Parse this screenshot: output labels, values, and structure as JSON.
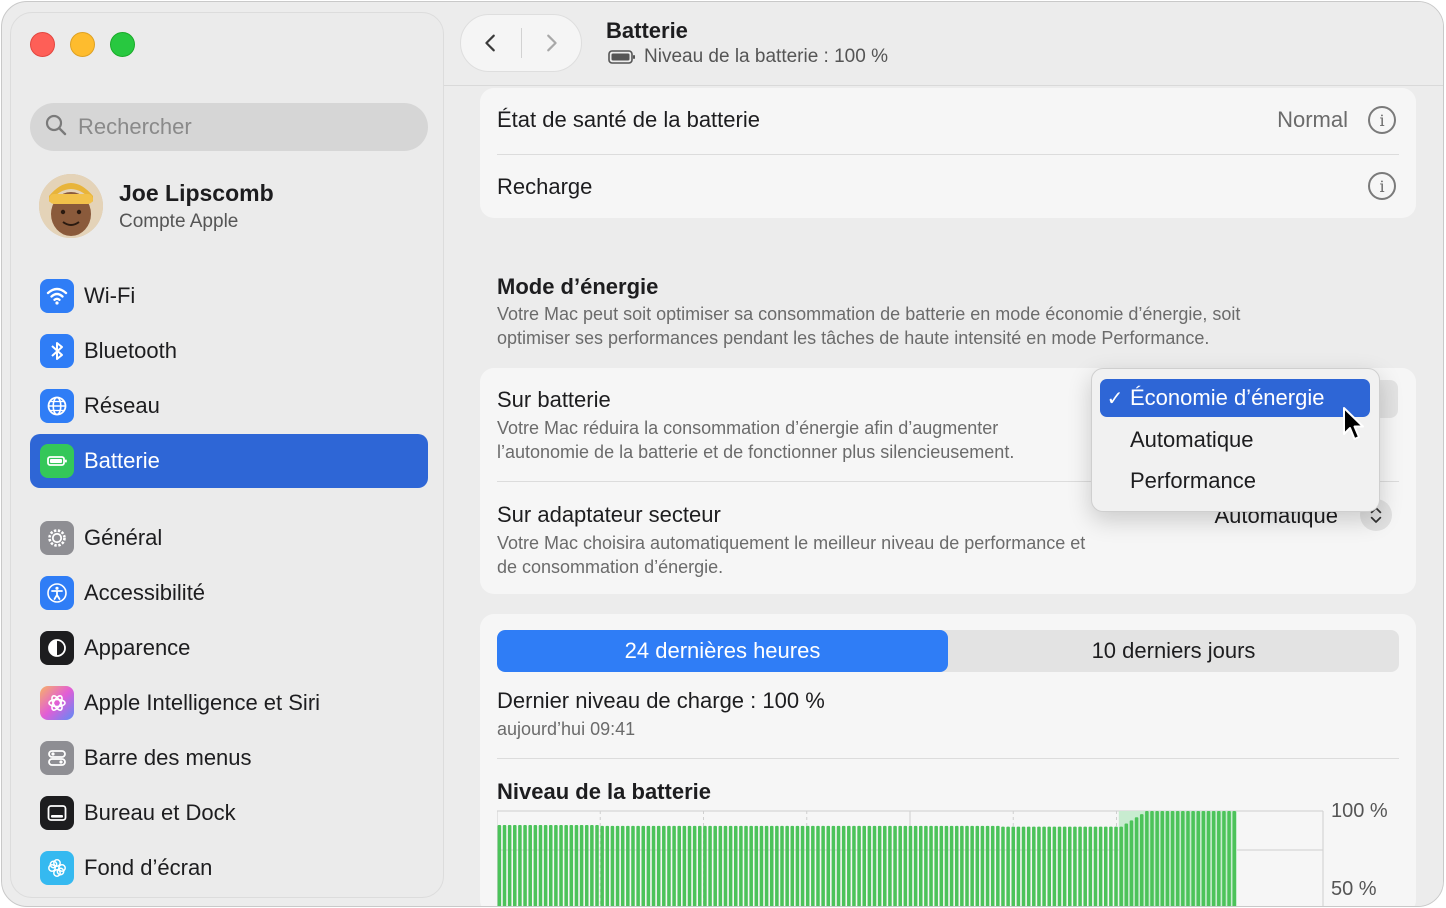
{
  "sidebar": {
    "search_placeholder": "Rechercher",
    "account": {
      "name": "Joe Lipscomb",
      "subtitle": "Compte Apple"
    },
    "items": [
      {
        "label": "Wi-Fi",
        "icon": "wifi-icon",
        "color": "#2f7df6"
      },
      {
        "label": "Bluetooth",
        "icon": "bluetooth-icon",
        "color": "#2f7df6"
      },
      {
        "label": "Réseau",
        "icon": "globe-icon",
        "color": "#2f7df6"
      },
      {
        "label": "Batterie",
        "icon": "battery-icon",
        "color": "#34c759",
        "active": true
      },
      {
        "label": "Général",
        "icon": "gear-icon",
        "color": "#8e8e93"
      },
      {
        "label": "Accessibilité",
        "icon": "accessibility-icon",
        "color": "#2f7df6"
      },
      {
        "label": "Apparence",
        "icon": "appearance-icon",
        "color": "#1d1d1f"
      },
      {
        "label": "Apple Intelligence et Siri",
        "icon": "siri-icon",
        "color": "#e25dd6"
      },
      {
        "label": "Barre des menus",
        "icon": "menubar-icon",
        "color": "#8e8e93"
      },
      {
        "label": "Bureau et Dock",
        "icon": "dock-icon",
        "color": "#1d1d1f"
      },
      {
        "label": "Fond d’écran",
        "icon": "wallpaper-icon",
        "color": "#35b9f0"
      }
    ]
  },
  "toolbar": {
    "title": "Batterie",
    "subtitle": "Niveau de la batterie : 100 %"
  },
  "health": {
    "label": "État de santé de la batterie",
    "value": "Normal",
    "charging_label": "Recharge"
  },
  "energy_mode": {
    "title": "Mode d’énergie",
    "description_line1": "Votre Mac peut soit optimiser sa consommation de batterie en mode économie d’énergie, soit",
    "description_line2": "optimiser ses performances pendant les tâches de haute intensité en mode Performance.",
    "on_battery": {
      "title": "Sur batterie",
      "desc_line1": "Votre Mac réduira la consommation d’énergie afin d’augmenter",
      "desc_line2": "l’autonomie de la batterie et de fonctionner plus silencieusement."
    },
    "on_adapter": {
      "title": "Sur adaptateur secteur",
      "desc_line1": "Votre Mac choisira automatiquement le meilleur niveau de performance et",
      "desc_line2": "de consommation d’énergie.",
      "value": "Automatique"
    },
    "popup": {
      "check": "✓",
      "options": [
        "Économie d’énergie",
        "Automatique",
        "Performance"
      ],
      "selected_index": 0
    }
  },
  "usage": {
    "tabs": [
      "24 dernières heures",
      "10 derniers jours"
    ],
    "active_tab": 0,
    "last_charge": "Dernier niveau de charge : 100 %",
    "last_charge_time": "aujourd’hui 09:41",
    "chart_title": "Niveau de la batterie"
  },
  "chart_data": {
    "type": "bar",
    "title": "Niveau de la batterie",
    "y_tick_labels": [
      "100 %",
      "50 %"
    ],
    "ylim": [
      0,
      100
    ],
    "bar_color": "#4cc35a",
    "charging_highlight_color": "#c8ecd0",
    "values": [
      82,
      82,
      82,
      82,
      82,
      82,
      82,
      82,
      82,
      82,
      82,
      82,
      82,
      82,
      82,
      82,
      82,
      82,
      82,
      82,
      81,
      81,
      81,
      81,
      81,
      81,
      81,
      81,
      81,
      81,
      81,
      81,
      81,
      81,
      81,
      81,
      81,
      81,
      81,
      81,
      81,
      81,
      81,
      81,
      81,
      81,
      81,
      81,
      81,
      81,
      81,
      81,
      81,
      81,
      81,
      81,
      81,
      81,
      81,
      81,
      81,
      81,
      81,
      81,
      81,
      81,
      81,
      81,
      81,
      81,
      81,
      81,
      81,
      81,
      81,
      81,
      81,
      81,
      81,
      81,
      81,
      81,
      81,
      81,
      81,
      81,
      81,
      81,
      81,
      81,
      81,
      81,
      81,
      81,
      81,
      81,
      81,
      81,
      80,
      80,
      80,
      80,
      80,
      80,
      80,
      80,
      80,
      80,
      80,
      80,
      80,
      80,
      80,
      80,
      80,
      80,
      80,
      80,
      80,
      80,
      80,
      80,
      84,
      88,
      92,
      96,
      100,
      100,
      100,
      100,
      100,
      100,
      100,
      100,
      100,
      100,
      100,
      100,
      100,
      100,
      100,
      100,
      100,
      100
    ]
  }
}
